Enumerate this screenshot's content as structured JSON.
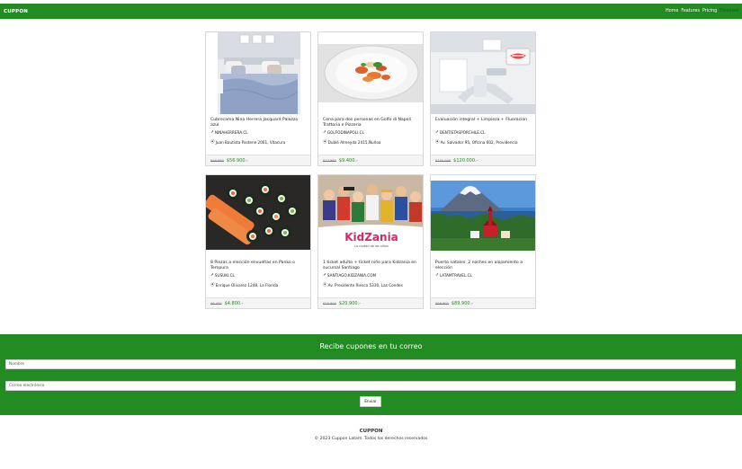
{
  "navbar": {
    "brand": "CUPPON",
    "links": [
      "Home",
      "Features",
      "Pricing",
      "Disabled"
    ]
  },
  "deals": [
    {
      "title": "Cubrecama Nina Herrera Jacquard Palazzo azul",
      "site": "NINAHERRERA.CL",
      "address": "Juan Bautista Pastene 2061, Vitacura",
      "old_price": "$99.990",
      "new_price": "$56.900.-",
      "image": "bedroom-photo"
    },
    {
      "title": "Cena para dos personas en Golfo di Napoli Trattoria e Pizzeria",
      "site": "GOLFODINAPOLI.CL",
      "address": "Dublé Almeyda 2415,Ñuñoa",
      "old_price": "$17.980",
      "new_price": "$9.400.-",
      "image": "pasta-dish-photo"
    },
    {
      "title": "Evaluación integral + Limpieza + Fluoración",
      "site": "DENTISTASPORCHILE.CL",
      "address": "Av. Salvador 95, Oficina 602, Providencia",
      "old_price": "$150.000",
      "new_price": "$120.000.-",
      "image": "dental-clinic-photo"
    },
    {
      "title": "8 Piezas a elección envueltas en Panko o Tempura",
      "site": "SUSUKI.CL",
      "address": "Enrique Olivarez 1248, La Florida",
      "old_price": "$6.400",
      "new_price": "$4.800.-",
      "image": "sushi-photo"
    },
    {
      "title": "1 ticket adulto + ticket niño para Kidzania en sucursal Santiago",
      "site": "SANTIAGO.KIDZANIA.COM",
      "address": "Av. Presidente Riesco 5330, Las Condes",
      "old_price": "$25.900",
      "new_price": "$20.900.-",
      "image": "kidzania-photo",
      "logo_text": "KidZania",
      "logo_sub": "La ciudad de los niños"
    },
    {
      "title": "Puerto natales: 2 noches en alojamiento a elección",
      "site": "LATAMTRAVEL.CL",
      "address": "",
      "old_price": "$99.900",
      "new_price": "$89.900.-",
      "image": "volcano-landscape-photo"
    }
  ],
  "newsletter": {
    "title": "Recibe cupones en tu correo",
    "name_placeholder": "Nombre",
    "email_placeholder": "Correo electrónico",
    "submit_label": "Enviar"
  },
  "footer": {
    "brand": "CUPPON",
    "copyright": "© 2023 Cuppon Latam. Todos los derechos reservados"
  },
  "colors": {
    "brand_green": "#228b22",
    "price_green": "#228b22"
  }
}
